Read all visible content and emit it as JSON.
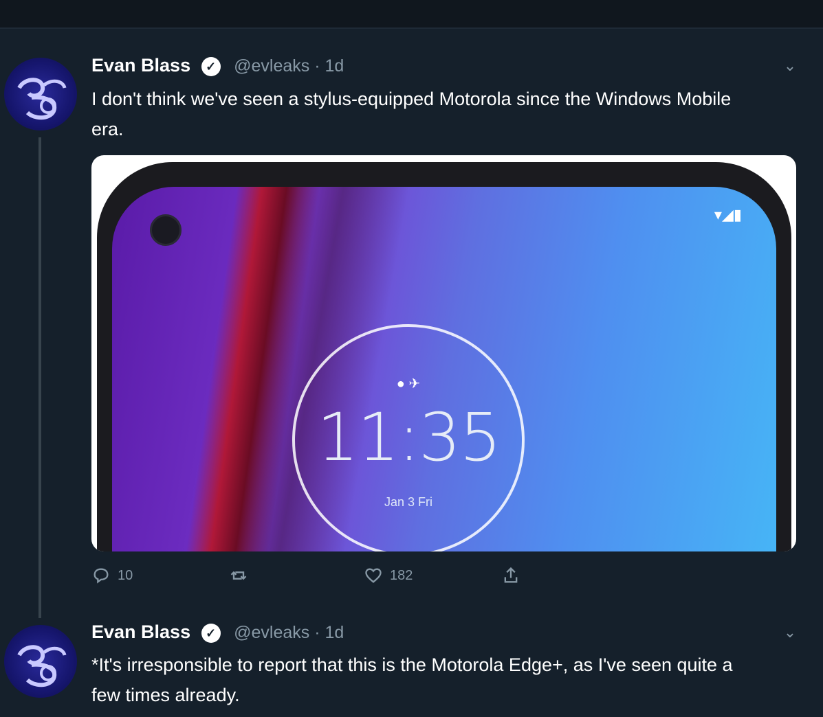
{
  "tweets": [
    {
      "author_name": "Evan Blass",
      "verified_mark": "✓",
      "handle_time": "@evleaks · 1d",
      "text": "I don't think we've seen a stylus-equipped Motorola since the Windows Mobile era.",
      "media": {
        "status_icons": "▾◢▮",
        "clock_icons": "● ✈",
        "clock_time": "11:35",
        "clock_date": "Jan 3 Fri"
      },
      "actions": {
        "reply_count": "10",
        "retweet_count": "",
        "like_count": "182"
      }
    },
    {
      "author_name": "Evan Blass",
      "verified_mark": "✓",
      "handle_time": "@evleaks · 1d",
      "text": "*It's irresponsible to report that this is the Motorola Edge+, as I've seen quite a few times already."
    }
  ],
  "colors": {
    "background": "#15202b",
    "text_primary": "#ffffff",
    "text_secondary": "#8899a6",
    "avatar": "#1a1a7a"
  },
  "icons": [
    "verified-icon",
    "chevron-down-icon",
    "reply-icon",
    "retweet-icon",
    "like-icon",
    "share-icon"
  ]
}
